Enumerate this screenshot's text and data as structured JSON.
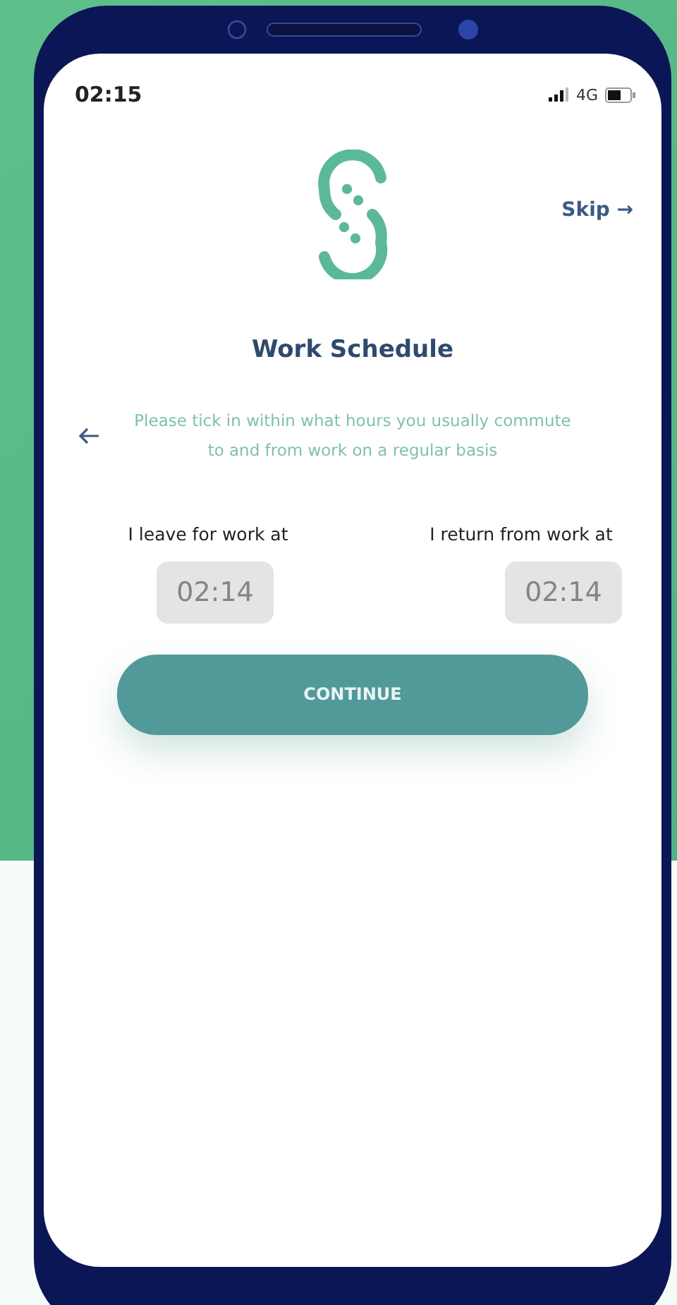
{
  "status_bar": {
    "time": "02:15",
    "network": "4G"
  },
  "header": {
    "skip": "Skip →"
  },
  "title": "Work Schedule",
  "description": "Please tick in within what hours you usually commute to and from work on a regular basis",
  "schedule": [
    {
      "label": "I leave for work at",
      "value": "02:14",
      "disabled": true
    },
    {
      "label": "I return from work at",
      "value": "02:14",
      "disabled": true
    }
  ],
  "button": "CONTINUE"
}
